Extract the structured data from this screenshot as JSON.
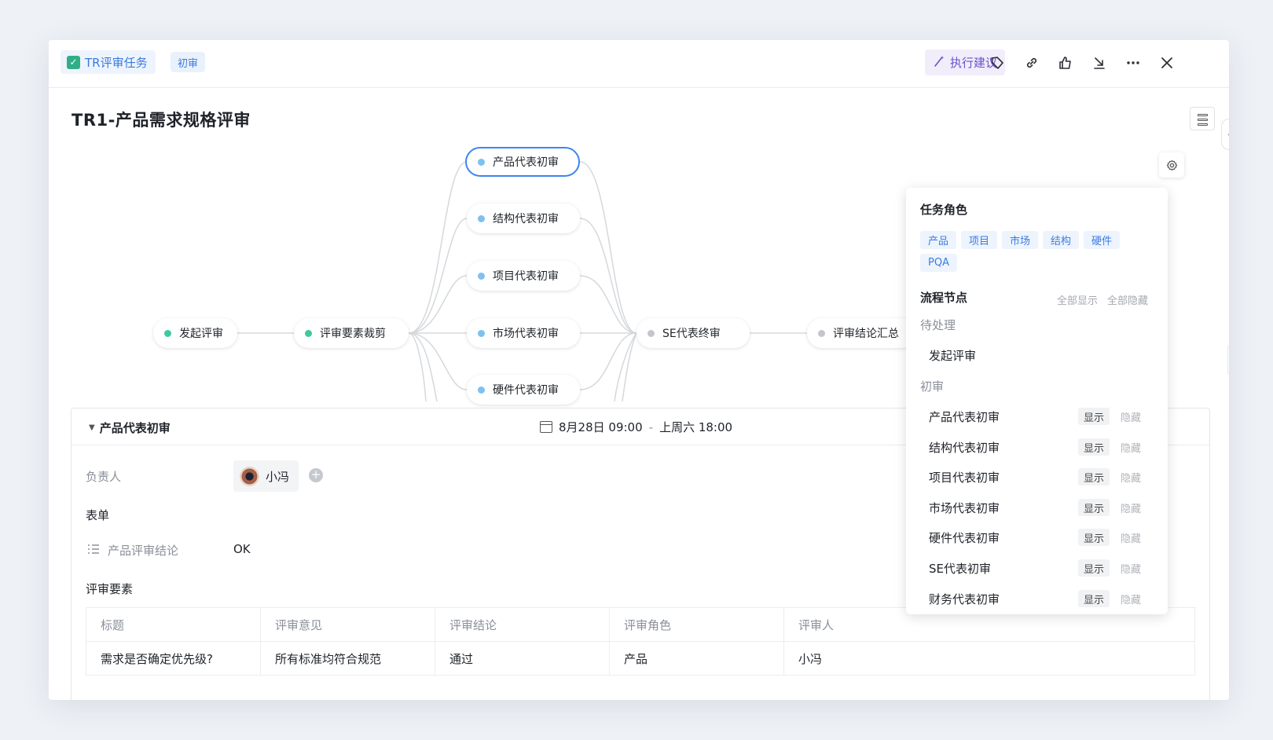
{
  "header": {
    "task_type": "TR评审任务",
    "stage": "初审",
    "suggest_label": "执行建议",
    "icons": [
      "tag-icon",
      "link-icon",
      "thumbs-up-icon",
      "download-icon",
      "more-icon",
      "close-icon"
    ]
  },
  "title": "TR1-产品需求规格评审",
  "flow": {
    "nodes": [
      {
        "label": "发起评审",
        "status": "done"
      },
      {
        "label": "评审要素裁剪",
        "status": "done"
      },
      {
        "label": "产品代表初审",
        "status": "active"
      },
      {
        "label": "结构代表初审",
        "status": "active"
      },
      {
        "label": "项目代表初审",
        "status": "active"
      },
      {
        "label": "市场代表初审",
        "status": "active"
      },
      {
        "label": "硬件代表初审",
        "status": "active"
      },
      {
        "label": "SE代表终审",
        "status": "pending"
      },
      {
        "label": "评审结论汇总",
        "status": "pending"
      }
    ]
  },
  "section": {
    "title": "产品代表初审",
    "start": "8月28日 09:00",
    "separator": "-",
    "end": "上周六 18:00",
    "assignee_label": "负责人",
    "assignee_name": "小冯",
    "form_label": "表单",
    "form_field_label": "产品评审结论",
    "form_field_value": "OK",
    "elements_label": "评审要素",
    "table": {
      "headers": [
        "标题",
        "评审意见",
        "评审结论",
        "评审角色",
        "评审人"
      ],
      "rows": [
        [
          "需求是否确定优先级?",
          "所有标准均符合规范",
          "通过",
          "产品",
          "小冯"
        ]
      ]
    }
  },
  "panel": {
    "roles_title": "任务角色",
    "roles": [
      "产品",
      "项目",
      "市场",
      "结构",
      "硬件",
      "PQA"
    ],
    "nodes_title": "流程节点",
    "show_all": "全部显示",
    "hide_all": "全部隐藏",
    "groups": [
      {
        "name": "待处理",
        "items": [
          "发起评审"
        ]
      },
      {
        "name": "初审",
        "items": [
          "产品代表初审",
          "结构代表初审",
          "项目代表初审",
          "市场代表初审",
          "硬件代表初审",
          "SE代表初审",
          "财务代表初审"
        ]
      }
    ],
    "show_label": "显示",
    "hide_label": "隐藏"
  },
  "colors": {
    "accent": "#3b86f0",
    "done_dot": "#3ecaa0",
    "active_dot": "#7cc1f2",
    "pending_dot": "#c3c7cd",
    "suggest": "#6a52c9"
  }
}
